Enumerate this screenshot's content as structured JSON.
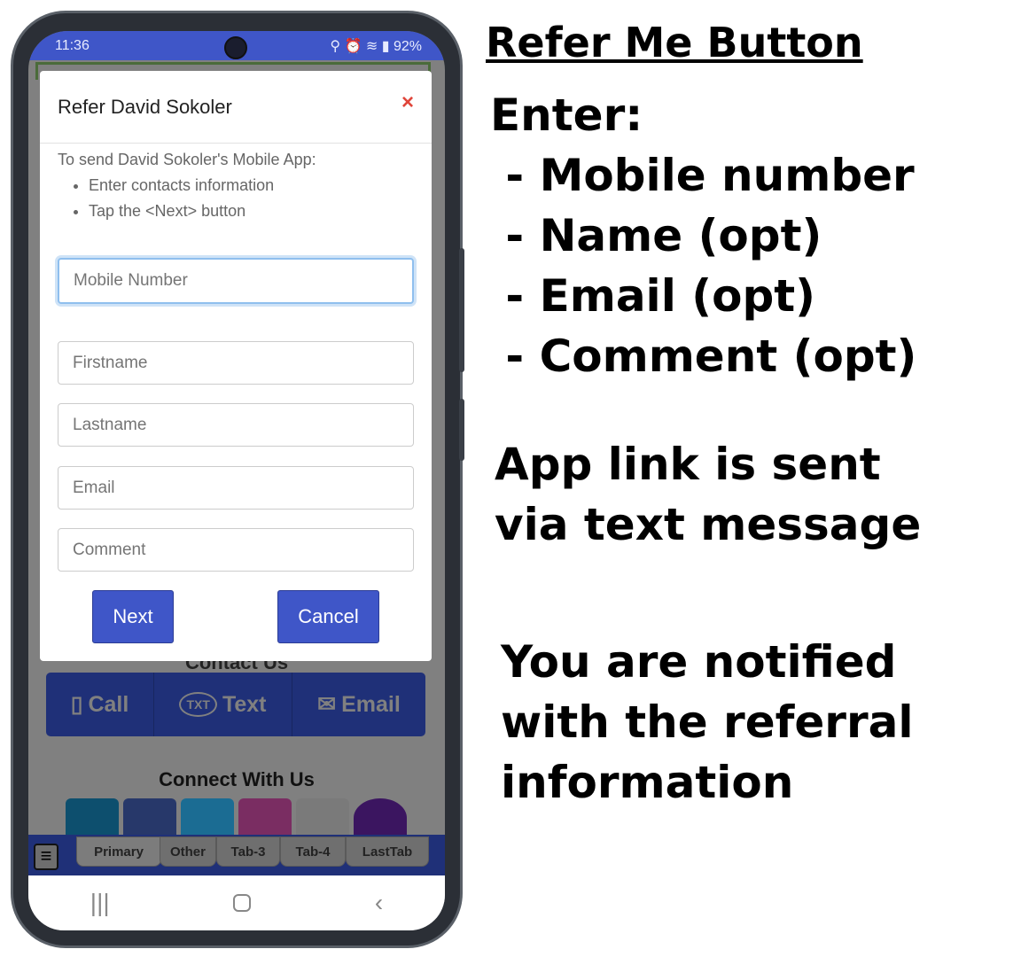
{
  "status_bar": {
    "time": "11:36",
    "battery": "92%"
  },
  "modal": {
    "title": "Refer David Sokoler",
    "close": "×",
    "intro": "To send David Sokoler's Mobile App:",
    "steps": [
      "Enter contacts information",
      "Tap the <Next> button"
    ],
    "fields": [
      {
        "placeholder": "Mobile Number"
      },
      {
        "placeholder": "Firstname"
      },
      {
        "placeholder": "Lastname"
      },
      {
        "placeholder": "Email"
      },
      {
        "placeholder": "Comment"
      }
    ],
    "next": "Next",
    "cancel": "Cancel"
  },
  "background": {
    "contact_title": "Contact Us",
    "call": "Call",
    "text": "Text",
    "email": "Email",
    "connect": "Connect With Us",
    "tabs": [
      "Primary",
      "Other",
      "Tab-3",
      "Tab-4",
      "LastTab"
    ]
  },
  "annotation": {
    "title": "Refer Me Button",
    "enter": "Enter:",
    "items": [
      " - Mobile number",
      " - Name (opt)",
      " - Email (opt)",
      " - Comment (opt)"
    ],
    "sent": [
      "App link is sent",
      "via text message"
    ],
    "notified": [
      "You are notified",
      "with the referral",
      "information"
    ]
  }
}
